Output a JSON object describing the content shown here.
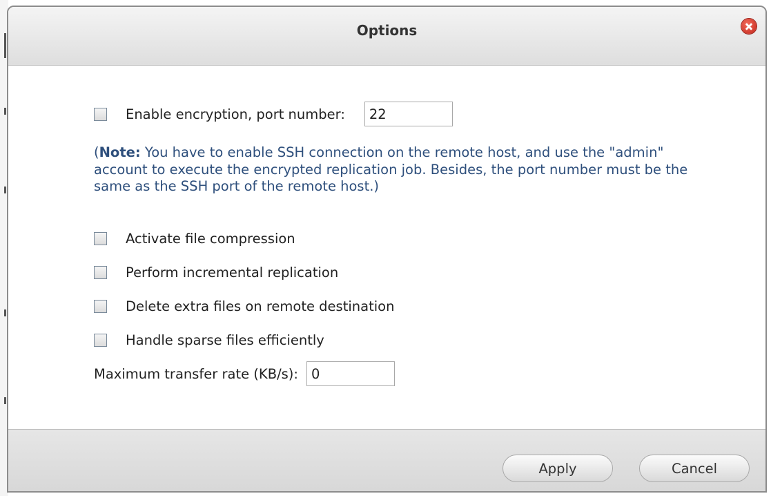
{
  "dialog": {
    "title": "Options",
    "close_icon": "close-icon"
  },
  "options": {
    "encryption": {
      "label": "Enable encryption, port number:",
      "checked": false,
      "port_value": "22"
    },
    "note": {
      "open_paren": "(",
      "bold": "Note:",
      "text": " You have to enable SSH connection on the remote host, and use the \"admin\" account to execute the encrypted replication job. Besides, the port number must be the same as the SSH port of the remote host.)"
    },
    "compression": {
      "label": "Activate file compression",
      "checked": false
    },
    "incremental": {
      "label": "Perform incremental replication",
      "checked": false
    },
    "delete_extra": {
      "label": "Delete extra files on remote destination",
      "checked": false
    },
    "sparse": {
      "label": "Handle sparse files efficiently",
      "checked": false
    },
    "max_rate": {
      "label": "Maximum transfer rate (KB/s):",
      "value": "0"
    }
  },
  "footer": {
    "apply_label": "Apply",
    "cancel_label": "Cancel"
  },
  "colors": {
    "note_text": "#2e4f7c",
    "close_button": "#d0372b"
  }
}
